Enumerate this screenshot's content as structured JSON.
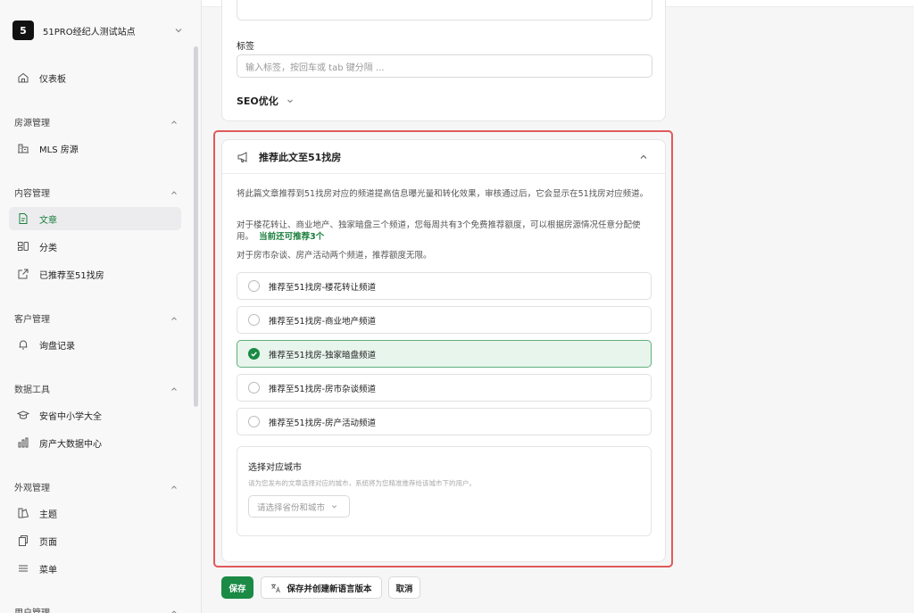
{
  "site": {
    "logo_text": "5",
    "name": "51PRO经纪人测试站点"
  },
  "sidebar": {
    "dashboard": "仪表板",
    "groups": [
      {
        "title": "房源管理",
        "items": [
          {
            "label": "MLS 房源",
            "icon": "building-icon"
          }
        ]
      },
      {
        "title": "内容管理",
        "items": [
          {
            "label": "文章",
            "icon": "document-icon",
            "active": true
          },
          {
            "label": "分类",
            "icon": "category-icon"
          },
          {
            "label": "已推荐至51找房",
            "icon": "share-icon"
          }
        ]
      },
      {
        "title": "客户管理",
        "items": [
          {
            "label": "询盘记录",
            "icon": "bell-icon"
          }
        ]
      },
      {
        "title": "数据工具",
        "items": [
          {
            "label": "安省中小学大全",
            "icon": "school-icon"
          },
          {
            "label": "房产大数据中心",
            "icon": "bar-chart-icon"
          }
        ]
      },
      {
        "title": "外观管理",
        "items": [
          {
            "label": "主题",
            "icon": "theme-icon"
          },
          {
            "label": "页面",
            "icon": "pages-icon"
          },
          {
            "label": "菜单",
            "icon": "menu-icon"
          }
        ]
      },
      {
        "title": "用户管理",
        "items": []
      }
    ]
  },
  "form": {
    "tags_label": "标签",
    "tags_placeholder": "输入标签，按回车或 tab 键分隔 ...",
    "seo_label": "SEO优化"
  },
  "recommend": {
    "title": "推荐此文至51找房",
    "desc1": "将此篇文章推荐到51找房对应的频道提高信息曝光量和转化效果，审核通过后，它会显示在51找房对应频道。",
    "desc2": "对于楼花转让、商业地产、独家暗盘三个频道，您每周共有3个免费推荐额度，可以根据房源情况任意分配使用。",
    "quota": "当前还可推荐3个",
    "desc3": "对于房市杂谈、房产活动两个频道，推荐额度无限。",
    "options": [
      {
        "label": "推荐至51找房-楼花转让频道",
        "selected": false
      },
      {
        "label": "推荐至51找房-商业地产频道",
        "selected": false
      },
      {
        "label": "推荐至51找房-独家暗盘频道",
        "selected": true
      },
      {
        "label": "推荐至51找房-房市杂谈频道",
        "selected": false
      },
      {
        "label": "推荐至51找房-房产活动频道",
        "selected": false
      }
    ],
    "city_title": "选择对应城市",
    "city_hint": "请为您发布的文章选择对应的城市，系统将为您精准推荐给该城市下的用户。",
    "city_placeholder": "请选择省份和城市"
  },
  "actions": {
    "save": "保存",
    "save_new_lang": "保存并创建新语言版本",
    "cancel": "取消"
  },
  "colors": {
    "accent": "#1a8a44",
    "highlight": "#e05a5a"
  }
}
